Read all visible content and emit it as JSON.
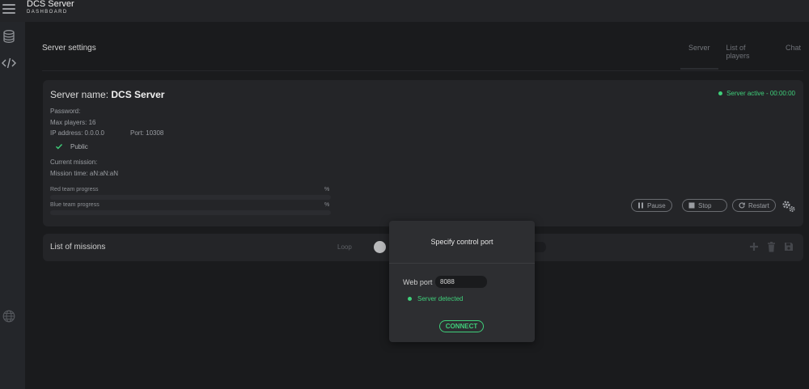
{
  "app": {
    "title": "DCS Server",
    "subtitle": "DASHBOARD"
  },
  "icons": {
    "menu": "hamburger-icon",
    "sidebar": [
      "database-icon",
      "code-icon",
      "globe-icon"
    ]
  },
  "header": {
    "title": "Server settings",
    "tabs": [
      {
        "label": "Server",
        "active": true
      },
      {
        "label": "List of players",
        "active": false
      },
      {
        "label": "Chat",
        "active": false
      }
    ]
  },
  "server": {
    "name_prefix": "Server name: ",
    "name": "DCS Server",
    "status": "Server active - 00:00:00",
    "password": "Password:",
    "max_players": "Max players: 16",
    "ip": "IP address: 0.0.0.0",
    "port": "Port: 10308",
    "public_label": "Public",
    "current_mission": "Current mission:",
    "mission_time": "Mission time: aN:aN:aN",
    "red_label": "Red team progress",
    "red_pct": "%",
    "blue_label": "Blue team progress",
    "blue_pct": "%",
    "buttons": {
      "pause": "Pause",
      "stop": "Stop",
      "restart": "Restart"
    }
  },
  "missions": {
    "title": "List of missions",
    "loop_label": "Loop"
  },
  "modal": {
    "title": "Specify control port",
    "port_label": "Web port",
    "port_value": "8088",
    "detected": "Server detected",
    "connect": "CONNECT"
  },
  "colors": {
    "accent": "#3fcf7a",
    "background": "#1a1b1d",
    "card": "#242528",
    "modal": "#2d2e31"
  }
}
